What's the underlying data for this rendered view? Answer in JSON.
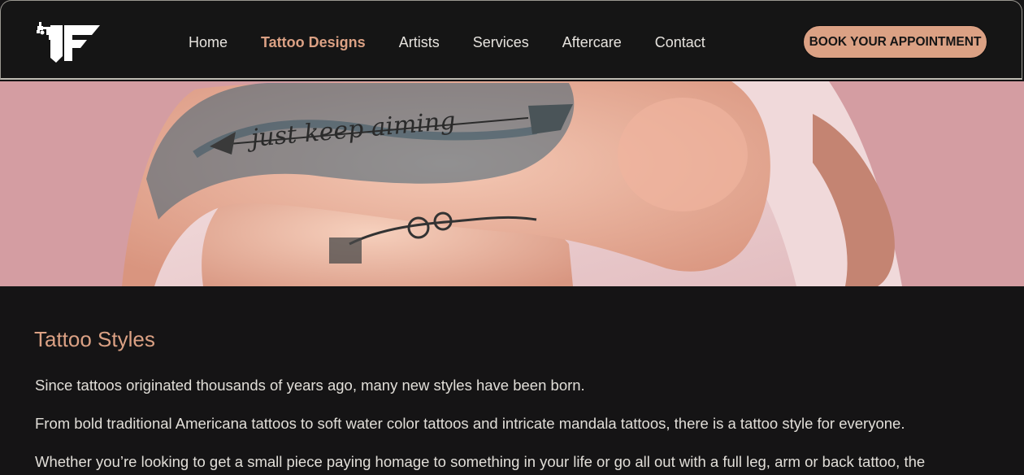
{
  "nav": {
    "logo_name": "tattoo-studio-logo",
    "links": [
      {
        "label": "Home",
        "active": false
      },
      {
        "label": "Tattoo Designs",
        "active": true
      },
      {
        "label": "Artists",
        "active": false
      },
      {
        "label": "Services",
        "active": false
      },
      {
        "label": "Aftercare",
        "active": false
      },
      {
        "label": "Contact",
        "active": false
      }
    ],
    "cta_label": "BOOK YOUR APPOINTMENT"
  },
  "hero": {
    "tattoo_script": "just keep aiming"
  },
  "content": {
    "title": "Tattoo Styles",
    "paragraphs": [
      "Since tattoos originated thousands of years ago, many new styles have been born.",
      "From bold traditional Americana tattoos to soft water color tattoos and intricate mandala tattoos, there is a tattoo style for everyone.",
      "Whether you’re looking to get a small piece paying homage to something in your life or go all out with a full leg, arm or back tattoo, the"
    ]
  },
  "colors": {
    "accent": "#dba184",
    "background": "#151415",
    "hero_bg": "#d49da2",
    "text": "#e1ded8"
  }
}
